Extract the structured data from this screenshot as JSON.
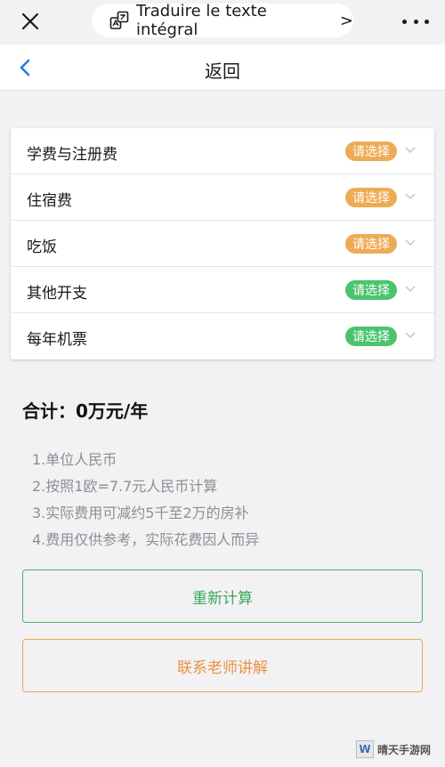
{
  "browser": {
    "translate_label": "Traduire le texte intégral",
    "translate_chevron": ">",
    "close_icon": "close-icon",
    "translate_icon": "translate-icon",
    "more_icon": "more-icon"
  },
  "nav": {
    "title": "返回",
    "back_icon": "chevron-left-icon"
  },
  "options": [
    {
      "label": "学费与注册费",
      "badge": "请选择",
      "badge_color": "#eeab55"
    },
    {
      "label": "住宿费",
      "badge": "请选择",
      "badge_color": "#eeab55"
    },
    {
      "label": "吃饭",
      "badge": "请选择",
      "badge_color": "#eeab55"
    },
    {
      "label": "其他开支",
      "badge": "请选择",
      "badge_color": "#4cc46d"
    },
    {
      "label": "每年机票",
      "badge": "请选择",
      "badge_color": "#4cc46d"
    }
  ],
  "total": {
    "text": "合计：0万元/年"
  },
  "notes": [
    "1.单位人民币",
    "2.按照1欧=7.7元人民币计算",
    "3.实际费用可减约5千至2万的房补",
    "4.费用仅供参考，实际花费因人而异"
  ],
  "buttons": {
    "recalculate": "重新计算",
    "contact": "联系老师讲解"
  },
  "colors": {
    "accent_green": "#3aa75c",
    "accent_orange": "#ea933f",
    "badge_orange": "#eeab55",
    "badge_green": "#4cc46d",
    "back_blue": "#1b7fe0"
  },
  "watermark": {
    "logo_letter": "W",
    "text": "晴天手游网"
  }
}
